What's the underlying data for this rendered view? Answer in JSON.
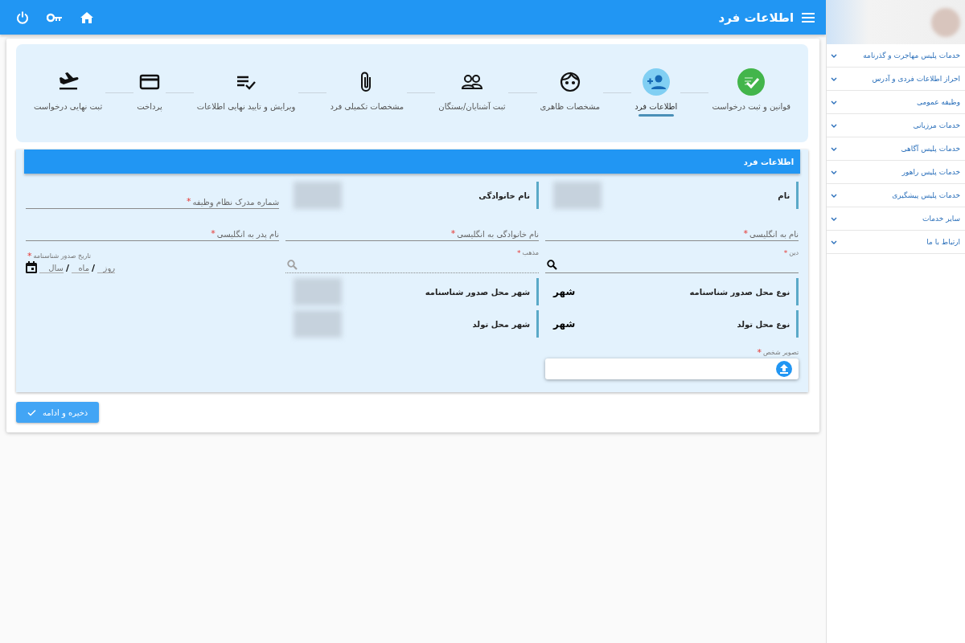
{
  "top_bar": {
    "title": "اطلاعات فرد"
  },
  "stepper": {
    "steps": [
      {
        "label": "قوانین و ثبت درخواست",
        "completed": true,
        "selected": false
      },
      {
        "label": "اطلاعات فرد",
        "completed": false,
        "selected": true
      },
      {
        "label": "مشخصات ظاهری",
        "completed": false,
        "selected": false
      },
      {
        "label": "ثبت آشنایان/بستگان",
        "completed": false,
        "selected": false
      },
      {
        "label": "مشخصات تکمیلی فرد",
        "completed": false,
        "selected": false
      },
      {
        "label": "ویرایش و تایید نهایی اطلاعات",
        "completed": false,
        "selected": false
      },
      {
        "label": "پرداخت",
        "completed": false,
        "selected": false
      },
      {
        "label": "ثبت نهایی درخواست",
        "completed": false,
        "selected": false
      }
    ]
  },
  "form": {
    "title": "اطلاعات فرد",
    "rows": [
      [
        {
          "kind": "display",
          "label": "نام",
          "blurred": true
        },
        {
          "kind": "display",
          "label": "نام خانوادگی",
          "blurred": true
        },
        {
          "kind": "input",
          "label": "شماره مدرک نظام وظیفه",
          "required_mark": "*"
        }
      ],
      [
        {
          "kind": "input",
          "label": "نام به انگلیسی",
          "required_mark": "*"
        },
        {
          "kind": "input",
          "label": "نام خانوادگی به انگلیسی",
          "required_mark": "*"
        },
        {
          "kind": "input",
          "label": "نام پدر به انگلیسی",
          "required_mark": "*"
        }
      ],
      [
        {
          "kind": "search",
          "label": "دین",
          "required_mark": "*",
          "disabled": false
        },
        {
          "kind": "search",
          "label": "مذهب",
          "required_mark": "*",
          "disabled": true
        },
        {
          "kind": "date",
          "label": "تاریخ صدور شناسنامه",
          "required_mark": "*",
          "parts": [
            {
              "placeholder": "روز",
              "separator": "/"
            },
            {
              "placeholder": "ماه",
              "separator": "/"
            },
            {
              "placeholder": "سال"
            }
          ]
        }
      ],
      [
        {
          "kind": "display",
          "label": "نوع محل صدور شناسنامه",
          "value": "شهر",
          "blurred": false
        },
        {
          "kind": "display",
          "label": "شهر محل صدور شناسنامه",
          "blurred": true
        }
      ],
      [
        {
          "kind": "display",
          "label": "نوع محل تولد",
          "value": "شهر",
          "blurred": false
        },
        {
          "kind": "display",
          "label": "شهر محل تولد",
          "blurred": true
        }
      ],
      [
        {
          "kind": "upload",
          "label": "تصویر شخص",
          "required_mark": "*"
        }
      ]
    ]
  },
  "save_button": {
    "label": "ذخیره و ادامه"
  },
  "sidebar": {
    "items": [
      {
        "label": "خدمات پلیس مهاجرت و گذرنامه"
      },
      {
        "label": "احراز اطلاعات فردی و آدرس"
      },
      {
        "label": "وظیفه عمومی"
      },
      {
        "label": "خدمات مرزبانی"
      },
      {
        "label": "خدمات پلیس آگاهی"
      },
      {
        "label": "خدمات پلیس راهور"
      },
      {
        "label": "خدمات پلیس پیشگیری"
      },
      {
        "label": "سایر خدمات"
      },
      {
        "label": "ارتباط با ما"
      }
    ]
  }
}
